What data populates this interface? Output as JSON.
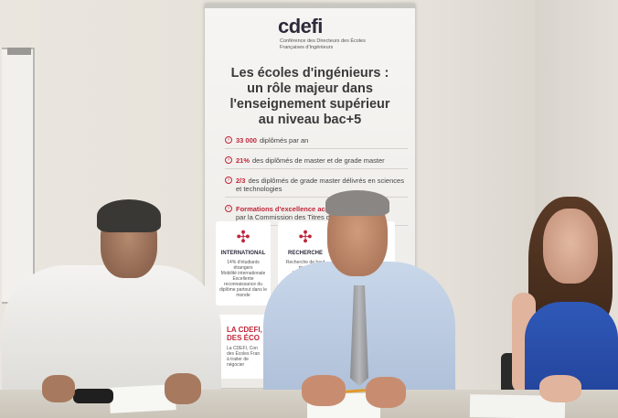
{
  "banner": {
    "logo": "cdefi",
    "logo_sub": "Conférence des Directeurs des Écoles Françaises d'Ingénieurs",
    "headline": "Les écoles d'ingénieurs :\nun rôle majeur dans\nl'enseignement supérieur\nau niveau bac+5",
    "facts": [
      {
        "num": "33 000",
        "text": "diplômés par an"
      },
      {
        "num": "21%",
        "text": "des diplômés de master et de grade master"
      },
      {
        "num": "2/3",
        "text": "des diplômés de grade master délivrés en sciences et technologies"
      },
      {
        "num": "Formations d'excellence accrédité",
        "text": "par la Commission des Titres d'I"
      }
    ],
    "panels": [
      {
        "title": "INTERNATIONAL",
        "text": "14% d'étudiants étrangers\nMobilité internationale\nExcellente reconnaissance du diplôme partout dans le monde"
      },
      {
        "title": "RECHERCHE",
        "text": "Recherche de haut niveau\nInnovation et\nCréat"
      },
      {
        "title": "",
        "text": ""
      }
    ],
    "cdefi_box": {
      "title": "LA CDEFI,\nDES ÉCO",
      "text": "La CDEFI, Con\ndes Écoles Fran\nà traiter de\nnégocier"
    }
  },
  "colors": {
    "accent": "#c0263a",
    "wall": "#e9e4dc",
    "table": "#d2ccc2"
  }
}
